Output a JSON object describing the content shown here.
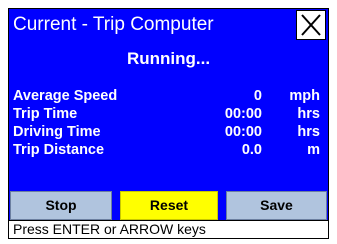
{
  "window": {
    "title": "Current - Trip Computer",
    "close_icon": "close-x-icon"
  },
  "status": "Running...",
  "stats": [
    {
      "label": "Average Speed",
      "value": "0",
      "unit": "mph"
    },
    {
      "label": "Trip Time",
      "value": "00:00",
      "unit": "hrs"
    },
    {
      "label": "Driving Time",
      "value": "00:00",
      "unit": "hrs"
    },
    {
      "label": "Trip Distance",
      "value": "0.0",
      "unit": "m"
    }
  ],
  "buttons": {
    "stop": "Stop",
    "reset": "Reset",
    "save": "Save"
  },
  "prompt": "Press ENTER or ARROW keys",
  "colors": {
    "background": "#0000ff",
    "button": "#b0c4de",
    "selected_button": "#ffff00"
  }
}
